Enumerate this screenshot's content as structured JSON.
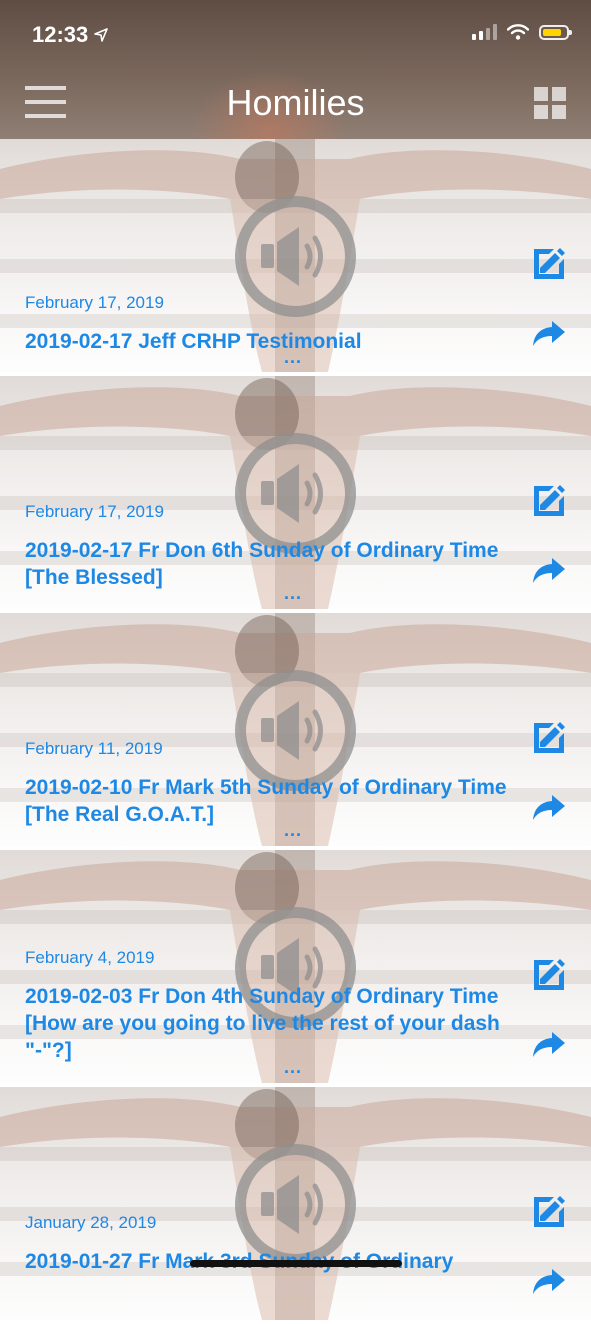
{
  "status_bar": {
    "time": "12:33"
  },
  "header": {
    "title": "Homilies"
  },
  "items": [
    {
      "date": "February 17, 2019",
      "title": "2019-02-17 Jeff CRHP Testimonial",
      "more": "..."
    },
    {
      "date": "February 17, 2019",
      "title": "2019-02-17 Fr Don 6th Sunday of Ordinary Time [The Blessed]",
      "more": "..."
    },
    {
      "date": "February 11, 2019",
      "title": "2019-02-10 Fr Mark 5th Sunday of Ordinary Time [The Real G.O.A.T.]",
      "more": "..."
    },
    {
      "date": "February 4, 2019",
      "title": "2019-02-03 Fr Don 4th Sunday of Ordinary Time [How are you going to live the rest of your dash \"-\"?]",
      "more": "..."
    },
    {
      "date": "January 28, 2019",
      "title": "2019-01-27 Fr Mark 3rd Sunday of Ordinary",
      "more": ""
    }
  ],
  "colors": {
    "accent": "#1e88e5",
    "header_bg": "#6b5a50"
  },
  "icons": {
    "menu": "hamburger-icon",
    "grid": "grid-view-icon",
    "audio": "speaker-icon",
    "edit": "edit-icon",
    "share": "share-icon"
  }
}
